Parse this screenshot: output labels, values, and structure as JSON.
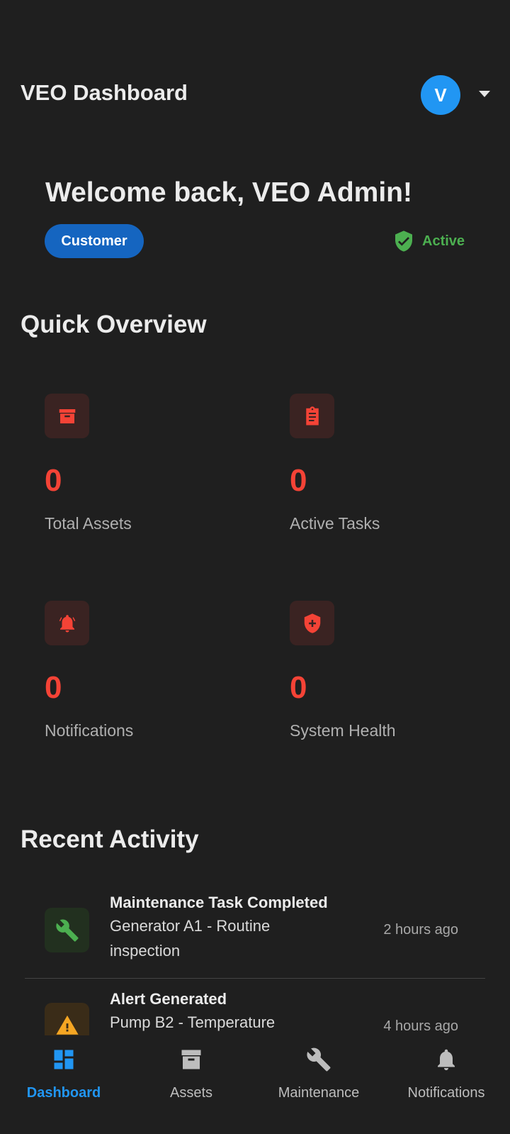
{
  "header": {
    "title": "VEO Dashboard",
    "avatar_initial": "V"
  },
  "welcome": {
    "greeting": "Welcome back, VEO Admin!",
    "role": "Customer",
    "status": "Active"
  },
  "overview": {
    "title": "Quick Overview",
    "stats": [
      {
        "icon": "archive-icon",
        "value": "0",
        "label": "Total Assets"
      },
      {
        "icon": "clipboard-icon",
        "value": "0",
        "label": "Active Tasks"
      },
      {
        "icon": "alarm-bell-icon",
        "value": "0",
        "label": "Notifications"
      },
      {
        "icon": "health-shield-icon",
        "value": "0",
        "label": "System Health"
      }
    ]
  },
  "recent": {
    "title": "Recent Activity",
    "items": [
      {
        "icon": "wrench-icon",
        "title": "Maintenance Task Completed",
        "description": "Generator A1 - Routine inspection",
        "time": "2 hours ago"
      },
      {
        "icon": "warning-icon",
        "title": "Alert Generated",
        "description": "Pump B2 - Temperature",
        "time": "4 hours ago"
      }
    ]
  },
  "nav": {
    "items": [
      {
        "label": "Dashboard",
        "icon": "dashboard-icon",
        "active": true
      },
      {
        "label": "Assets",
        "icon": "archive-icon"
      },
      {
        "label": "Maintenance",
        "icon": "wrench-icon"
      },
      {
        "label": "Notifications",
        "icon": "bell-icon"
      }
    ]
  },
  "colors": {
    "background": "#1f1f1f",
    "accent_blue": "#2196f3",
    "chip_blue": "#1565c0",
    "stat_red": "#f44336",
    "active_green": "#4caf50",
    "warning_amber": "#f5a623"
  }
}
